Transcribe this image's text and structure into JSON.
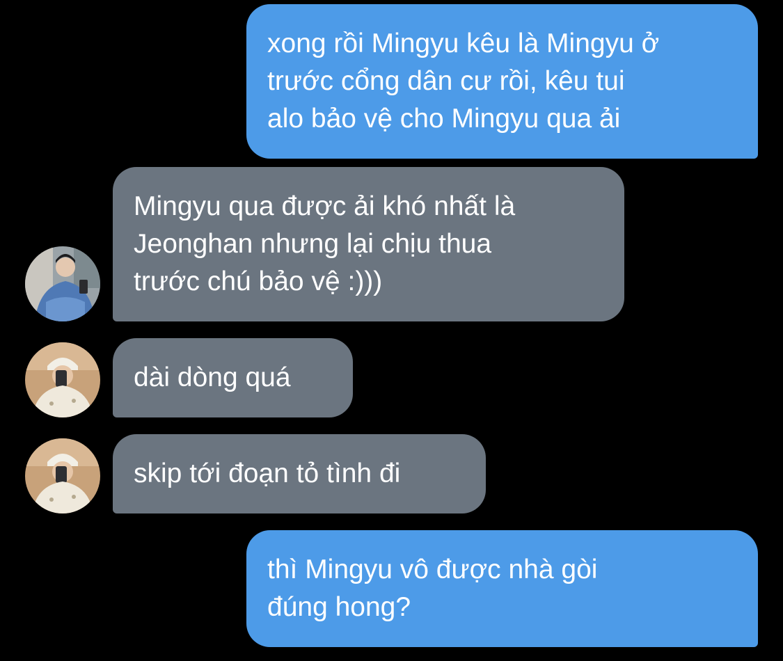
{
  "conversation": {
    "messages": [
      {
        "sender": "me",
        "text": "xong rồi Mingyu kêu là Mingyu ở\ntrước cổng dân cư rồi, kêu tui\nalo bảo vệ cho Mingyu qua ải"
      },
      {
        "sender": "other",
        "avatar": "avatar-photo-denim-jacket",
        "text": "Mingyu qua được ải khó nhất là\nJeonghan nhưng lại chịu thua\ntrước chú bảo vệ :)))"
      },
      {
        "sender": "other",
        "avatar": "avatar-photo-white-beanie",
        "text": "dài dòng quá"
      },
      {
        "sender": "other",
        "avatar": "avatar-photo-white-beanie",
        "text": "skip tới đoạn tỏ tình đi"
      },
      {
        "sender": "me",
        "text": "thì Mingyu vô được nhà gòi\nđúng hong?"
      }
    ]
  },
  "colors": {
    "background": "#000000",
    "sent_bubble": "#4d9be8",
    "received_bubble": "#6b7580",
    "text": "#ffffff"
  }
}
